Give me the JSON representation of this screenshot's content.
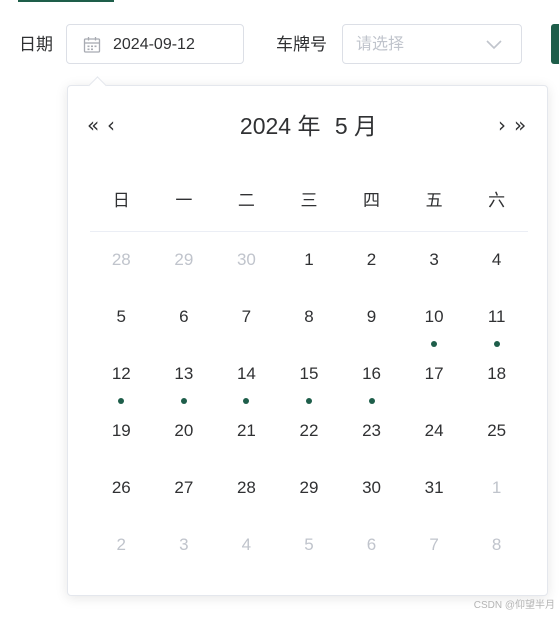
{
  "filters": {
    "date_label": "日期",
    "date_value": "2024-09-12",
    "plate_label": "车牌号",
    "plate_placeholder": "请选择"
  },
  "picker": {
    "prev_year": "«",
    "prev_month": "‹",
    "next_month": "›",
    "next_year": "»",
    "year_label": "2024 年",
    "month_label": "5 月",
    "weekdays": [
      "日",
      "一",
      "二",
      "三",
      "四",
      "五",
      "六"
    ],
    "weeks": [
      [
        {
          "d": "28",
          "dim": true
        },
        {
          "d": "29",
          "dim": true
        },
        {
          "d": "30",
          "dim": true
        },
        {
          "d": "1"
        },
        {
          "d": "2"
        },
        {
          "d": "3"
        },
        {
          "d": "4"
        }
      ],
      [
        {
          "d": "5"
        },
        {
          "d": "6"
        },
        {
          "d": "7"
        },
        {
          "d": "8"
        },
        {
          "d": "9"
        },
        {
          "d": "10",
          "dot": true
        },
        {
          "d": "11",
          "dot": true
        }
      ],
      [
        {
          "d": "12",
          "dot": true
        },
        {
          "d": "13",
          "dot": true
        },
        {
          "d": "14",
          "dot": true
        },
        {
          "d": "15",
          "dot": true
        },
        {
          "d": "16",
          "dot": true
        },
        {
          "d": "17"
        },
        {
          "d": "18"
        }
      ],
      [
        {
          "d": "19"
        },
        {
          "d": "20"
        },
        {
          "d": "21"
        },
        {
          "d": "22"
        },
        {
          "d": "23"
        },
        {
          "d": "24"
        },
        {
          "d": "25"
        }
      ],
      [
        {
          "d": "26"
        },
        {
          "d": "27"
        },
        {
          "d": "28"
        },
        {
          "d": "29"
        },
        {
          "d": "30"
        },
        {
          "d": "31"
        },
        {
          "d": "1",
          "dim": true
        }
      ],
      [
        {
          "d": "2",
          "dim": true
        },
        {
          "d": "3",
          "dim": true
        },
        {
          "d": "4",
          "dim": true
        },
        {
          "d": "5",
          "dim": true
        },
        {
          "d": "6",
          "dim": true
        },
        {
          "d": "7",
          "dim": true
        },
        {
          "d": "8",
          "dim": true
        }
      ]
    ]
  },
  "watermark": "CSDN @仰望半月",
  "colors": {
    "accent": "#1e5e4a",
    "text": "#303133",
    "muted": "#c0c4cc",
    "border": "#dcdfe6"
  },
  "icons": {
    "date_icon": "calendar-icon",
    "select_icon": "chevron-down-icon"
  }
}
